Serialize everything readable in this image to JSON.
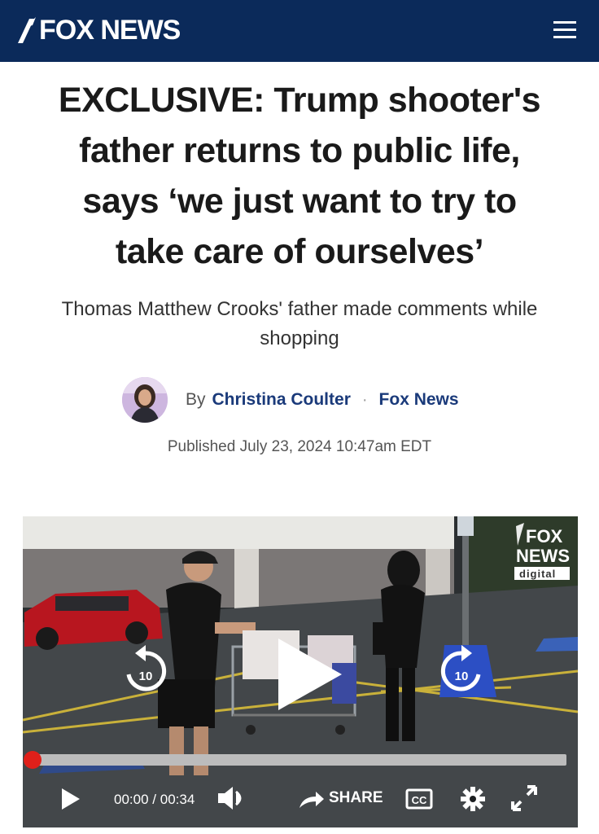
{
  "header": {
    "logo_text": "FOX NEWS",
    "bg_color": "#0b2a5a"
  },
  "article": {
    "headline_lines": [
      "EXCLUSIVE: Trump shooter's",
      "father returns to public life,",
      "says ‘we just want to try to",
      "take care of ourselves’"
    ],
    "subhead_lines": [
      "Thomas Matthew Crooks' father made comments while",
      "shopping"
    ],
    "by_label": "By",
    "author": "Christina Coulter",
    "separator": "·",
    "outlet": "Fox News",
    "published": "Published July 23, 2024 10:47am EDT"
  },
  "video": {
    "watermark_line1": "FOX",
    "watermark_line2": "NEWS",
    "watermark_line3": "digital",
    "skip_back_label": "10",
    "skip_forward_label": "10",
    "progress_fraction": 0.0,
    "current_time": "00:00",
    "time_separator": "/",
    "duration": "00:34",
    "share_label": "SHARE",
    "cc_label": "CC"
  },
  "icons": [
    "menu-icon",
    "replay-10-icon",
    "play-icon",
    "forward-10-icon",
    "volume-icon",
    "share-icon",
    "cc-icon",
    "settings-icon",
    "fullscreen-icon"
  ]
}
